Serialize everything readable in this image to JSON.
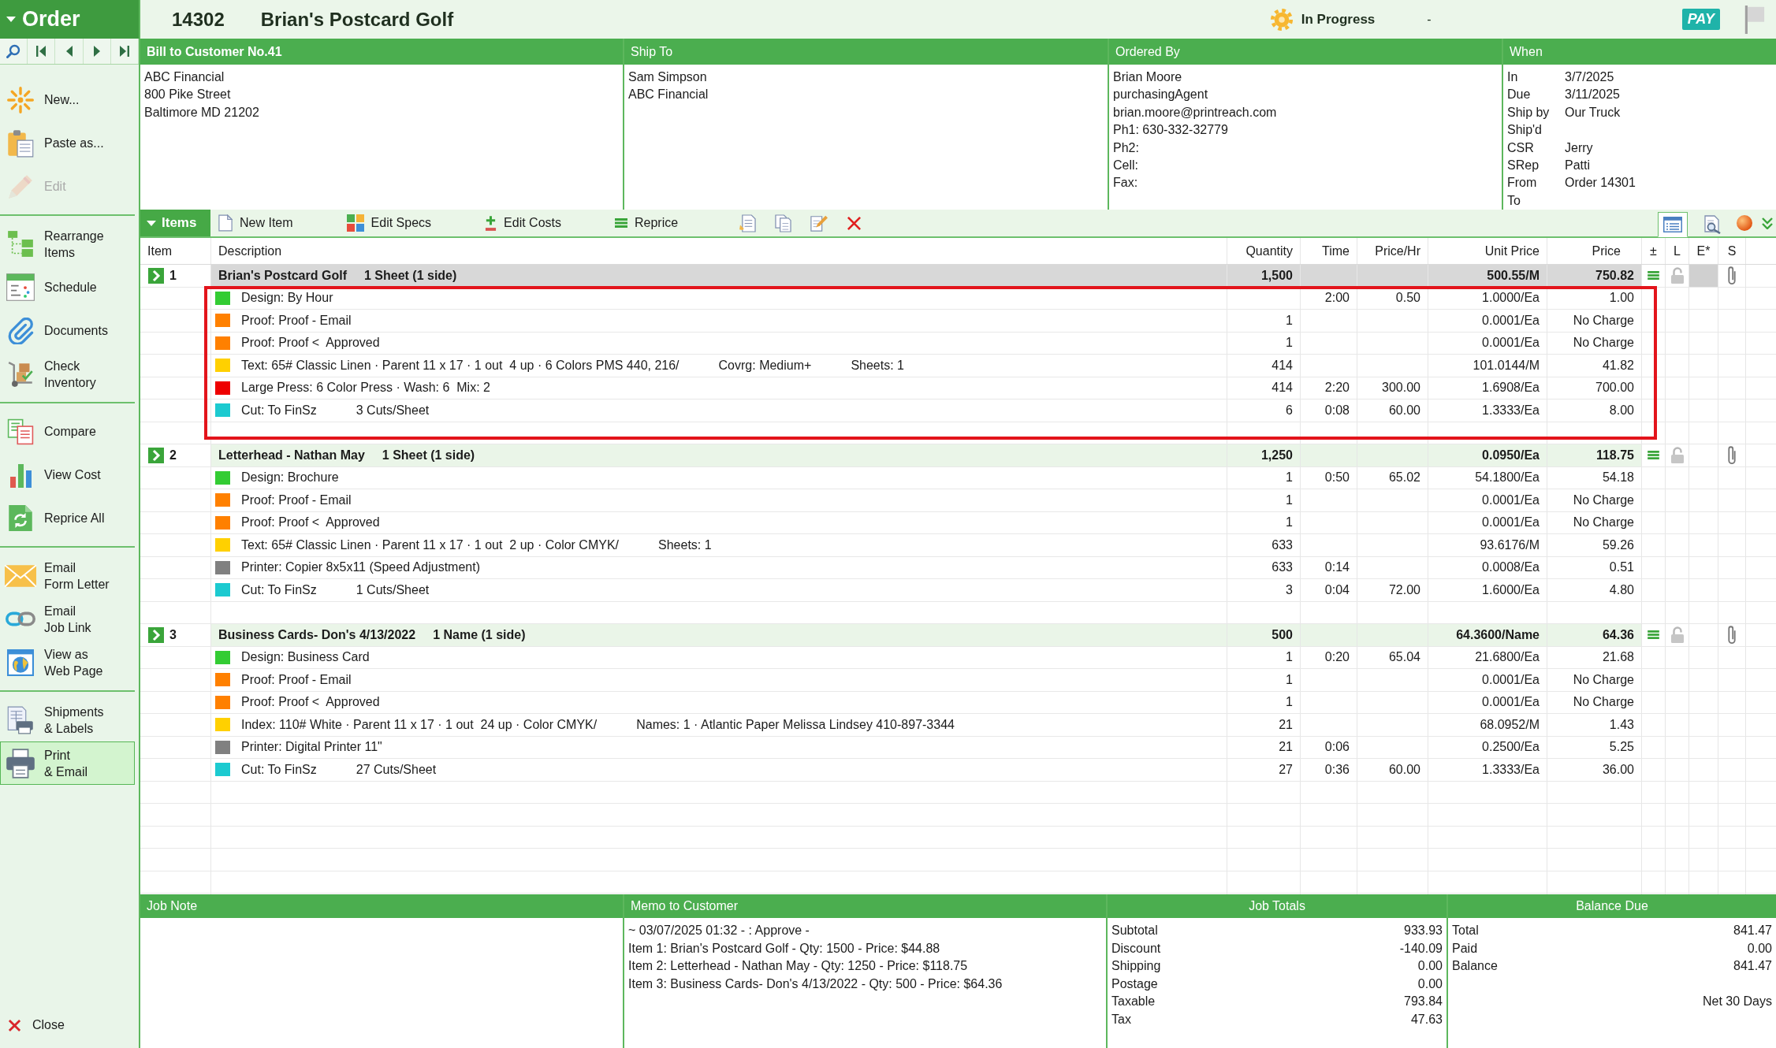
{
  "order": {
    "title": "Order",
    "number": "14302",
    "job_name": "Brian's Postcard Golf",
    "status": "In Progress",
    "status_detail": "-",
    "pay_badge": "PAY"
  },
  "sidebar": {
    "groups": [
      {
        "items": [
          {
            "label": "New...",
            "disabled": false,
            "selected": false
          },
          {
            "label": "Paste as...",
            "disabled": false,
            "selected": false
          },
          {
            "label": "Edit",
            "disabled": true,
            "selected": false
          }
        ]
      },
      {
        "items": [
          {
            "label": "Rearrange\nItems",
            "disabled": false,
            "selected": false
          },
          {
            "label": "Schedule",
            "disabled": false,
            "selected": false
          },
          {
            "label": "Documents",
            "disabled": false,
            "selected": false
          },
          {
            "label": "Check\nInventory",
            "disabled": false,
            "selected": false
          }
        ]
      },
      {
        "items": [
          {
            "label": "Compare",
            "disabled": false,
            "selected": false
          },
          {
            "label": "View Cost",
            "disabled": false,
            "selected": false
          },
          {
            "label": "Reprice All",
            "disabled": false,
            "selected": false
          }
        ]
      },
      {
        "items": [
          {
            "label": "Email\nForm Letter",
            "disabled": false,
            "selected": false
          },
          {
            "label": "Email\nJob Link",
            "disabled": false,
            "selected": false
          },
          {
            "label": "View as\nWeb Page",
            "disabled": false,
            "selected": false
          }
        ]
      },
      {
        "items": [
          {
            "label": "Shipments\n& Labels",
            "disabled": false,
            "selected": false
          },
          {
            "label": "Print\n& Email",
            "disabled": false,
            "selected": true
          }
        ]
      }
    ],
    "close": "Close"
  },
  "info_panels": [
    {
      "kind": "customer",
      "title": "Bill to Customer No.41",
      "lines": [
        "ABC Financial",
        "800 Pike Street",
        "Baltimore MD 21202"
      ]
    },
    {
      "kind": "ship_to",
      "title": "Ship To",
      "lines": [
        "Sam Simpson",
        "ABC Financial"
      ]
    },
    {
      "kind": "contact",
      "title": "Ordered By",
      "lines": [
        "Brian Moore",
        "purchasingAgent",
        "brian.moore@printreach.com",
        "Ph1: 630-332-32779",
        "Ph2:",
        "Cell:",
        "Fax:"
      ]
    },
    {
      "kind": "dates",
      "title": "When",
      "fields": [
        {
          "label": "In",
          "value": "3/7/2025"
        },
        {
          "label": "Due",
          "value": "3/11/2025"
        },
        {
          "label": "Ship by",
          "value": "Our Truck"
        },
        {
          "label": "Ship'd"
        },
        {
          "label": "CSR",
          "value": "Jerry"
        },
        {
          "label": "SRep",
          "value": "Patti"
        },
        {
          "label": "From",
          "value": "Order 14301"
        },
        {
          "label": "To"
        }
      ]
    }
  ],
  "items_toolbar": {
    "tab": "Items",
    "buttons": [
      "New Item",
      "Edit Specs",
      "Edit Costs",
      "Reprice"
    ],
    "view_toggles": [
      {
        "selected": true
      },
      {
        "selected": false
      }
    ]
  },
  "table": {
    "columns": [
      "Item",
      "Description",
      "Quantity",
      "Time",
      "Price/Hr",
      "Unit Price",
      "Price",
      "±",
      "L",
      "E*",
      "S"
    ],
    "items": [
      {
        "number": "1",
        "title": "Brian's Postcard Golf",
        "spec": "1 Sheet (1 side)",
        "quantity": "1,500",
        "unit_price": "500.55/M",
        "price": "750.82",
        "selected": true,
        "highlighted": true,
        "lines": [
          {
            "color": "#33cc33",
            "description": [
              "Design: By Hour"
            ],
            "time": "2:00",
            "price_hr": "0.50",
            "unit_price": "1.0000/Ea",
            "price": "1.00"
          },
          {
            "color": "#ff8000",
            "description": [
              "Proof: Proof - Email"
            ],
            "quantity": "1",
            "unit_price": "0.0001/Ea",
            "price": "No Charge"
          },
          {
            "color": "#ff8000",
            "description": [
              "Proof: Proof <  Approved"
            ],
            "quantity": "1",
            "unit_price": "0.0001/Ea",
            "price": "No Charge"
          },
          {
            "color": "#ffd000",
            "description": [
              "Text: 65# Classic Linen · Parent 11 x 17 · 1 out  4 up · 6 Colors PMS 440, 216/",
              "Covrg: Medium+",
              "Sheets: 1"
            ],
            "quantity": "414",
            "unit_price": "101.0144/M",
            "price": "41.82"
          },
          {
            "color": "#ee0000",
            "description": [
              "Large Press: 6 Color Press · Wash: 6  Mix: 2"
            ],
            "quantity": "414",
            "time": "2:20",
            "price_hr": "300.00",
            "unit_price": "1.6908/Ea",
            "price": "700.00"
          },
          {
            "color": "#1ccad0",
            "description": [
              "Cut: To FinSz",
              "3 Cuts/Sheet"
            ],
            "quantity": "6",
            "time": "0:08",
            "price_hr": "60.00",
            "unit_price": "1.3333/Ea",
            "price": "8.00"
          }
        ]
      },
      {
        "number": "2",
        "title": "Letterhead - Nathan May",
        "spec": "1 Sheet (1 side)",
        "quantity": "1,250",
        "unit_price": "0.0950/Ea",
        "price": "118.75",
        "selected": false,
        "highlighted": false,
        "lines": [
          {
            "color": "#33cc33",
            "description": [
              "Design: Brochure"
            ],
            "quantity": "1",
            "time": "0:50",
            "price_hr": "65.02",
            "unit_price": "54.1800/Ea",
            "price": "54.18"
          },
          {
            "color": "#ff8000",
            "description": [
              "Proof: Proof - Email"
            ],
            "quantity": "1",
            "unit_price": "0.0001/Ea",
            "price": "No Charge"
          },
          {
            "color": "#ff8000",
            "description": [
              "Proof: Proof <  Approved"
            ],
            "quantity": "1",
            "unit_price": "0.0001/Ea",
            "price": "No Charge"
          },
          {
            "color": "#ffd000",
            "description": [
              "Text: 65# Classic Linen · Parent 11 x 17 · 1 out  2 up · Color CMYK/",
              "Sheets: 1"
            ],
            "quantity": "633",
            "unit_price": "93.6176/M",
            "price": "59.26"
          },
          {
            "color": "#808080",
            "description": [
              "Printer: Copier 8x5x11 (Speed Adjustment)"
            ],
            "quantity": "633",
            "time": "0:14",
            "unit_price": "0.0008/Ea",
            "price": "0.51"
          },
          {
            "color": "#1ccad0",
            "description": [
              "Cut: To FinSz",
              "1 Cuts/Sheet"
            ],
            "quantity": "3",
            "time": "0:04",
            "price_hr": "72.00",
            "unit_price": "1.6000/Ea",
            "price": "4.80"
          }
        ]
      },
      {
        "number": "3",
        "title": "Business Cards- Don's 4/13/2022",
        "spec": "1 Name (1 side)",
        "quantity": "500",
        "unit_price": "64.3600/Name",
        "price": "64.36",
        "selected": false,
        "highlighted": false,
        "lines": [
          {
            "color": "#33cc33",
            "description": [
              "Design: Business Card"
            ],
            "quantity": "1",
            "time": "0:20",
            "price_hr": "65.04",
            "unit_price": "21.6800/Ea",
            "price": "21.68"
          },
          {
            "color": "#ff8000",
            "description": [
              "Proof: Proof - Email"
            ],
            "quantity": "1",
            "unit_price": "0.0001/Ea",
            "price": "No Charge"
          },
          {
            "color": "#ff8000",
            "description": [
              "Proof: Proof <  Approved"
            ],
            "quantity": "1",
            "unit_price": "0.0001/Ea",
            "price": "No Charge"
          },
          {
            "color": "#ffd000",
            "description": [
              "Index: 110# White · Parent 11 x 17 · 1 out  24 up · Color CMYK/",
              "Names: 1 · Atlantic Paper Melissa Lindsey 410-897-3344"
            ],
            "quantity": "21",
            "unit_price": "68.0952/M",
            "price": "1.43"
          },
          {
            "color": "#808080",
            "description": [
              "Printer: Digital Printer 11\""
            ],
            "quantity": "21",
            "time": "0:06",
            "unit_price": "0.2500/Ea",
            "price": "5.25"
          },
          {
            "color": "#1ccad0",
            "description": [
              "Cut: To FinSz",
              "27 Cuts/Sheet"
            ],
            "quantity": "27",
            "time": "0:36",
            "price_hr": "60.00",
            "unit_price": "1.3333/Ea",
            "price": "36.00"
          }
        ]
      }
    ]
  },
  "job_note": {
    "title": "Job Note"
  },
  "memo": {
    "title": "Memo to Customer",
    "lines": [
      "~ 03/07/2025 01:32 - : Approve -",
      "Item 1: Brian's Postcard Golf - Qty: 1500 - Price: $44.88",
      "Item 2: Letterhead - Nathan May - Qty: 1250 - Price: $118.75",
      "Item 3: Business Cards- Don's 4/13/2022 - Qty: 500 - Price: $64.36"
    ]
  },
  "job_totals": {
    "title": "Job Totals",
    "rows": [
      {
        "label": "Subtotal",
        "value": "933.93"
      },
      {
        "label": "Discount",
        "value": "-140.09"
      },
      {
        "label": "Shipping",
        "value": "0.00"
      },
      {
        "label": "Postage",
        "value": "0.00"
      },
      {
        "label": "Taxable",
        "value": "793.84"
      },
      {
        "label": "Tax",
        "value": "47.63"
      }
    ]
  },
  "balance_due": {
    "title": "Balance Due",
    "rows": [
      {
        "label": "Total",
        "value": "841.47"
      },
      {
        "label": "Paid",
        "value": "0.00"
      },
      {
        "label": "Balance",
        "value": "841.47"
      }
    ],
    "terms": "Net 30 Days"
  }
}
